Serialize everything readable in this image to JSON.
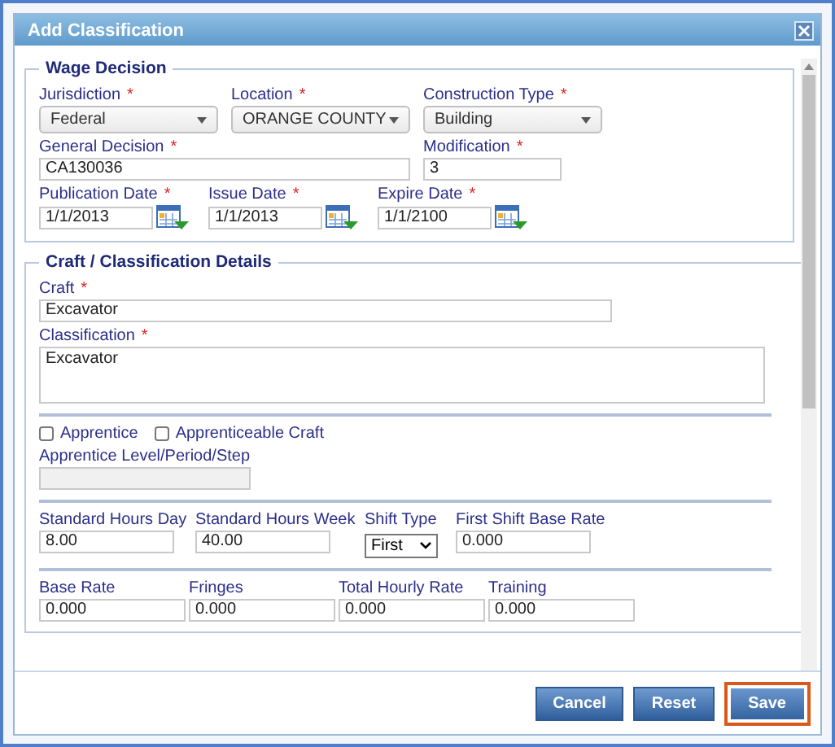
{
  "dialog": {
    "title": "Add Classification"
  },
  "sections": [
    {
      "legend": "Wage Decision",
      "rows": [
        {
          "divider": false,
          "fields": [
            {
              "kind": "select",
              "label": "Jurisdiction",
              "required": true,
              "value": "Federal"
            },
            {
              "kind": "select",
              "label": "Location",
              "required": true,
              "value": "ORANGE COUNTY"
            },
            {
              "kind": "select",
              "label": "Construction Type",
              "required": true,
              "value": "Building"
            }
          ]
        },
        {
          "divider": false,
          "fields": [
            {
              "kind": "text",
              "label": "General Decision",
              "required": true,
              "value": "CA130036"
            },
            {
              "kind": "text",
              "label": "Modification",
              "required": true,
              "value": "3"
            }
          ]
        },
        {
          "divider": false,
          "fields": [
            {
              "kind": "date",
              "label": "Publication Date",
              "required": true,
              "value": "1/1/2013"
            },
            {
              "kind": "date",
              "label": "Issue Date",
              "required": true,
              "value": "1/1/2013"
            },
            {
              "kind": "date",
              "label": "Expire Date",
              "required": true,
              "value": "1/1/2100"
            }
          ]
        }
      ]
    },
    {
      "legend": "Craft / Classification Details",
      "rows": [
        {
          "divider": false,
          "fields": [
            {
              "kind": "text",
              "label": "Craft",
              "required": true,
              "value": "Excavator"
            }
          ]
        },
        {
          "divider": false,
          "fields": [
            {
              "kind": "textarea",
              "label": "Classification",
              "required": true,
              "value": "Excavator"
            }
          ]
        },
        {
          "divider": true,
          "fields": [
            {
              "kind": "checkbox",
              "label": "Apprentice",
              "checked": false
            },
            {
              "kind": "checkbox",
              "label": "Apprenticeable Craft",
              "checked": false
            }
          ]
        },
        {
          "divider": false,
          "fields": [
            {
              "kind": "text",
              "label": "Apprentice Level/Period/Step",
              "required": false,
              "disabled": true
            }
          ]
        },
        {
          "divider": true,
          "fields": [
            {
              "kind": "text",
              "label": "Standard Hours Day",
              "required": false,
              "value": "8.00"
            },
            {
              "kind": "text",
              "label": "Standard Hours Week",
              "required": false,
              "value": "40.00"
            },
            {
              "kind": "choice",
              "label": "Shift Type",
              "required": false,
              "value": "First"
            },
            {
              "kind": "text",
              "label": "First Shift Base Rate",
              "required": false,
              "value": "0.000"
            }
          ]
        },
        {
          "divider": true,
          "fields": [
            {
              "kind": "text",
              "label": "Base Rate",
              "required": false,
              "value": "0.000"
            },
            {
              "kind": "text",
              "label": "Fringes",
              "required": false,
              "value": "0.000"
            },
            {
              "kind": "text",
              "label": "Total Hourly Rate",
              "required": false,
              "value": "0.000"
            },
            {
              "kind": "text",
              "label": "Training",
              "required": false,
              "value": "0.000"
            }
          ]
        }
      ]
    }
  ],
  "required_mark": "*",
  "buttons": [
    {
      "label": "Cancel",
      "highlighted": false
    },
    {
      "label": "Reset",
      "highlighted": false
    },
    {
      "label": "Save",
      "highlighted": true
    }
  ]
}
